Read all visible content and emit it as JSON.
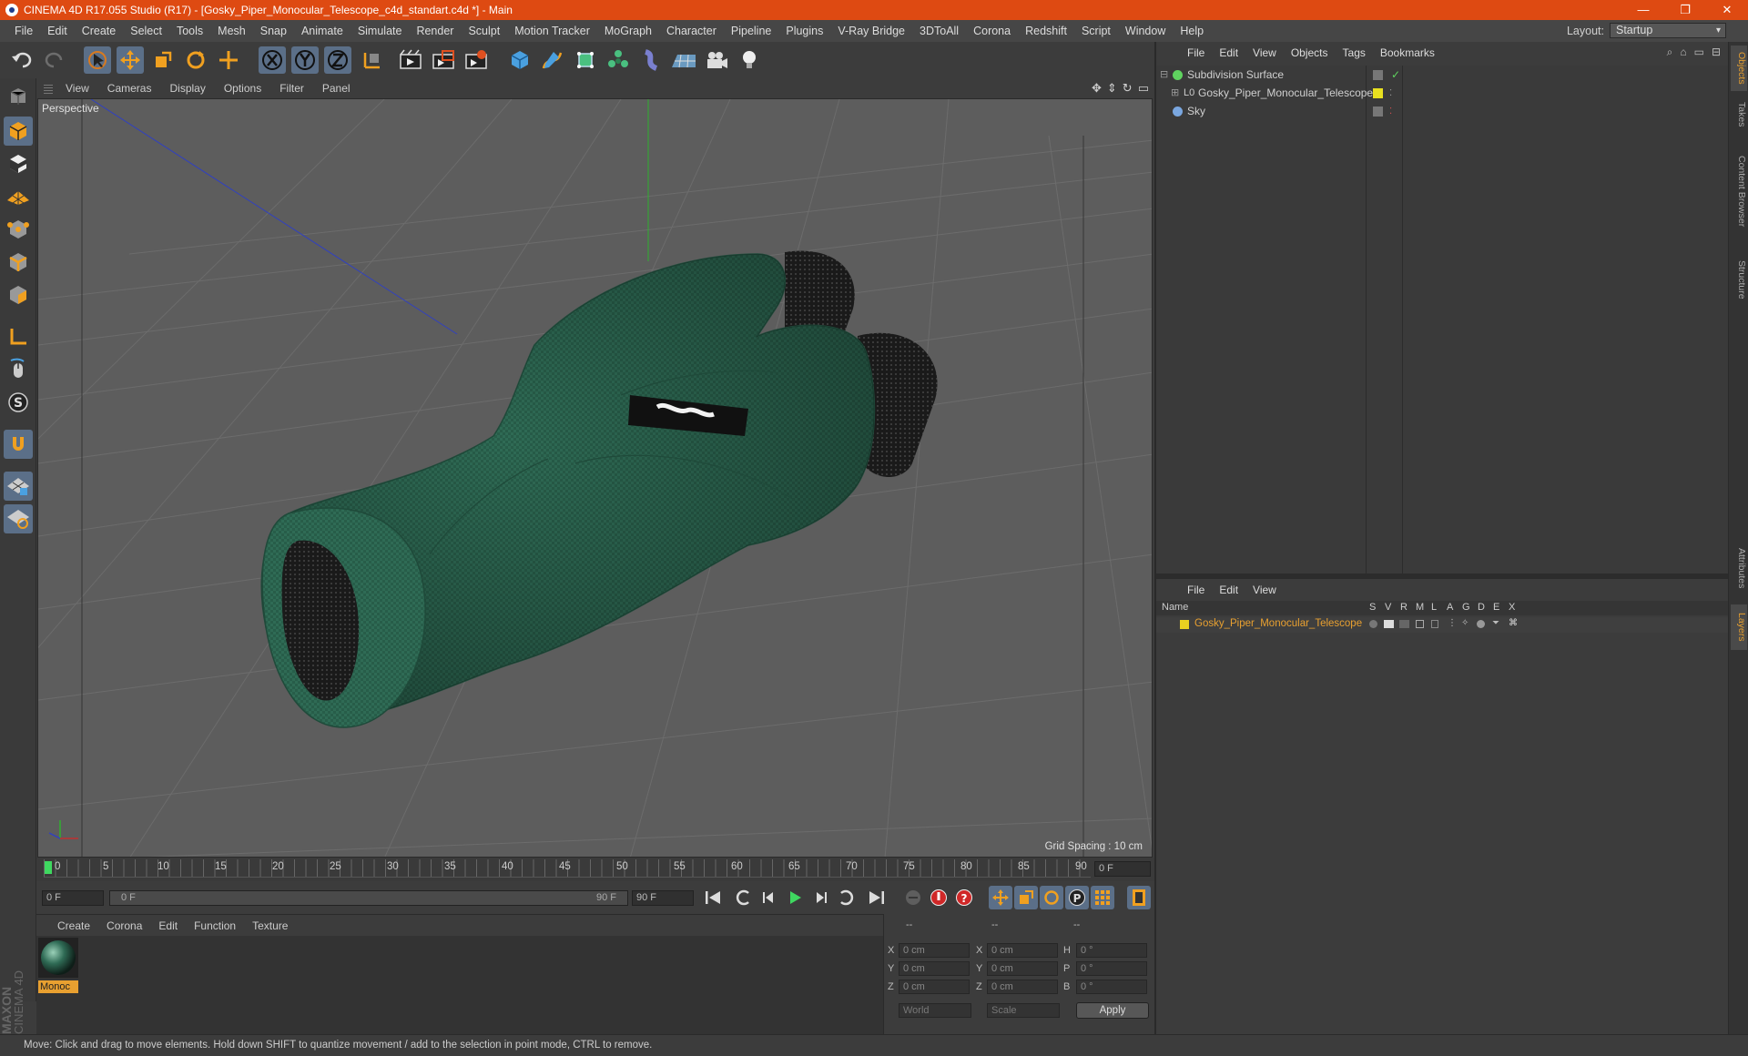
{
  "window": {
    "title": "CINEMA 4D R17.055 Studio (R17) - [Gosky_Piper_Monocular_Telescope_c4d_standart.c4d *] - Main",
    "controls": [
      "—",
      "❐",
      "✕"
    ]
  },
  "menubar": {
    "items": [
      "File",
      "Edit",
      "Create",
      "Select",
      "Tools",
      "Mesh",
      "Snap",
      "Animate",
      "Simulate",
      "Render",
      "Sculpt",
      "Motion Tracker",
      "MoGraph",
      "Character",
      "Pipeline",
      "Plugins",
      "V-Ray Bridge",
      "3DToAll",
      "Corona",
      "Redshift",
      "Script",
      "Window",
      "Help"
    ],
    "layout_label": "Layout:",
    "layout_value": "Startup"
  },
  "viewport": {
    "menu": [
      "View",
      "Cameras",
      "Display",
      "Options",
      "Filter",
      "Panel"
    ],
    "label": "Perspective",
    "grid_spacing": "Grid Spacing : 10 cm"
  },
  "timeline": {
    "ticks": [
      "0",
      "5",
      "10",
      "15",
      "20",
      "25",
      "30",
      "35",
      "40",
      "45",
      "50",
      "55",
      "60",
      "65",
      "70",
      "75",
      "80",
      "85",
      "90"
    ],
    "current_frame": "0 F",
    "start_field": "0 F",
    "range_start": "0 F",
    "range_end": "90 F",
    "end_field": "90 F"
  },
  "materials": {
    "menu": [
      "Create",
      "Corona",
      "Edit",
      "Function",
      "Texture"
    ],
    "items": [
      {
        "name": "Monoc"
      }
    ]
  },
  "coordinates": {
    "headers": [
      "--",
      "--",
      "--"
    ],
    "rows": [
      {
        "a": "X",
        "av": "0 cm",
        "b": "X",
        "bv": "0 cm",
        "c": "H",
        "cv": "0 °"
      },
      {
        "a": "Y",
        "av": "0 cm",
        "b": "Y",
        "bv": "0 cm",
        "c": "P",
        "cv": "0 °"
      },
      {
        "a": "Z",
        "av": "0 cm",
        "b": "Z",
        "bv": "0 cm",
        "c": "B",
        "cv": "0 °"
      }
    ],
    "world": "World",
    "scale": "Scale",
    "apply": "Apply"
  },
  "object_manager": {
    "menu": [
      "File",
      "Edit",
      "View",
      "Objects",
      "Tags",
      "Bookmarks"
    ],
    "objects": [
      {
        "name": "Subdivision Surface",
        "color": "#5fd35f"
      },
      {
        "name": "Gosky_Piper_Monocular_Telescope",
        "color": "#e8e020"
      },
      {
        "name": "Sky",
        "color": "#7aa7e0"
      }
    ]
  },
  "layer_manager": {
    "menu": [
      "File",
      "Edit",
      "View"
    ],
    "name_header": "Name",
    "columns": [
      "S",
      "V",
      "R",
      "M",
      "L",
      "A",
      "G",
      "D",
      "E",
      "X"
    ],
    "layers": [
      {
        "name": "Gosky_Piper_Monocular_Telescope",
        "color": "#e8d020"
      }
    ]
  },
  "side_tabs": [
    "Objects",
    "Takes",
    "Content Browser",
    "Structure",
    "Attributes",
    "Layers"
  ],
  "brand": {
    "maxon": "MAXON",
    "cinema": "CINEMA 4D"
  },
  "status": "Move: Click and drag to move elements. Hold down SHIFT to quantize movement / add to the selection in point mode, CTRL to remove.",
  "colors": {
    "titlebar": "#de4a12",
    "accent": "#e8a030",
    "model_green": "#2f6b55"
  }
}
